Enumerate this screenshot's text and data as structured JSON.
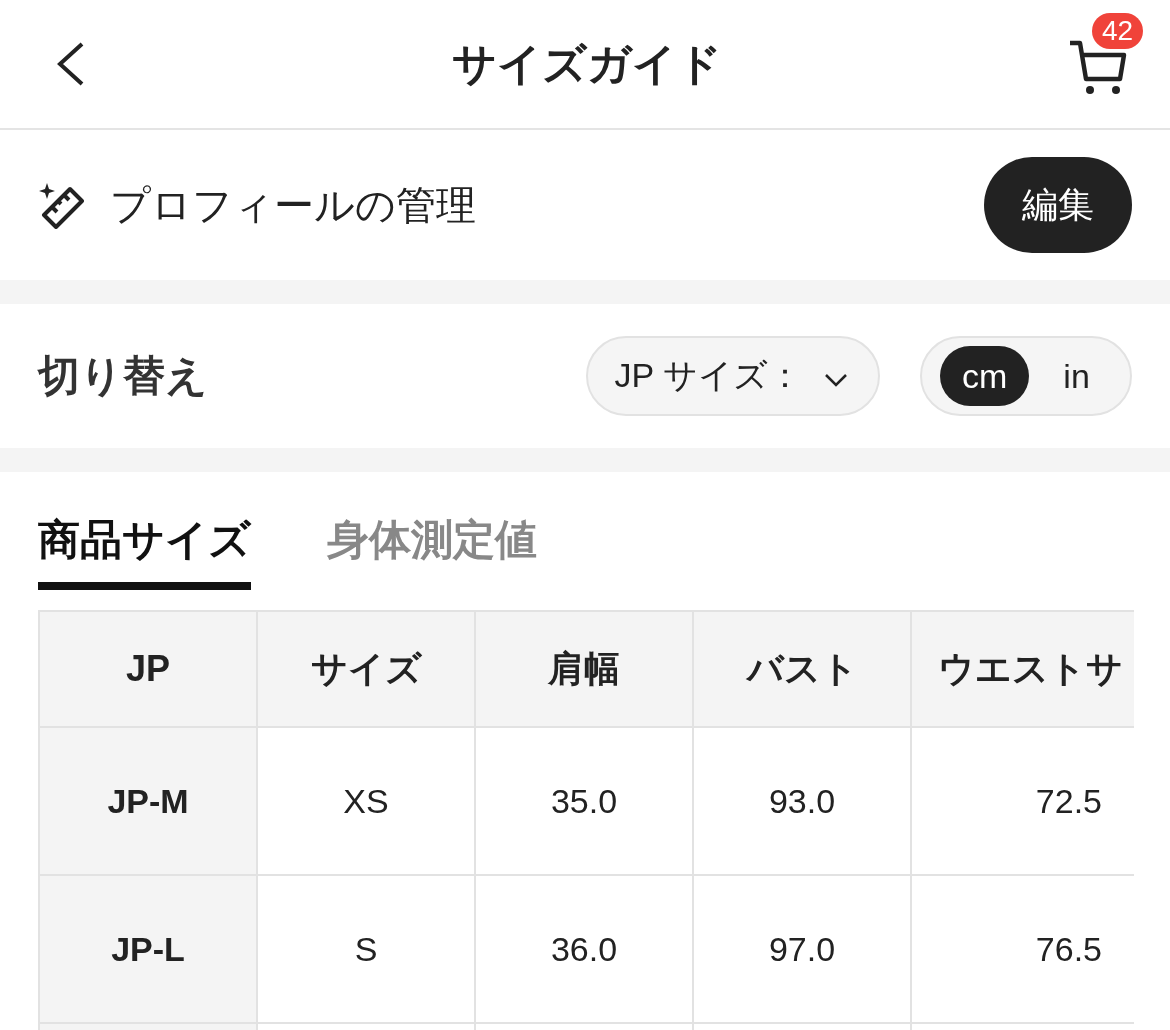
{
  "header": {
    "title": "サイズガイド",
    "cart_badge": "42"
  },
  "profile": {
    "label": "プロフィールの管理",
    "button": "編集"
  },
  "switcher": {
    "label": "切り替え",
    "size_select": "JP サイズ：",
    "units": [
      {
        "label": "cm",
        "selected": true
      },
      {
        "label": "in",
        "selected": false
      }
    ]
  },
  "tabs": [
    {
      "label": "商品サイズ",
      "selected": true
    },
    {
      "label": "身体測定値",
      "selected": false
    }
  ],
  "table": {
    "columns": [
      "JP",
      "サイズ",
      "肩幅",
      "バスト",
      "ウエストサ"
    ],
    "rows": [
      [
        "JP-M",
        "XS",
        "35.0",
        "93.0",
        "72.5"
      ],
      [
        "JP-L",
        "S",
        "36.0",
        "97.0",
        "76.5"
      ]
    ]
  }
}
